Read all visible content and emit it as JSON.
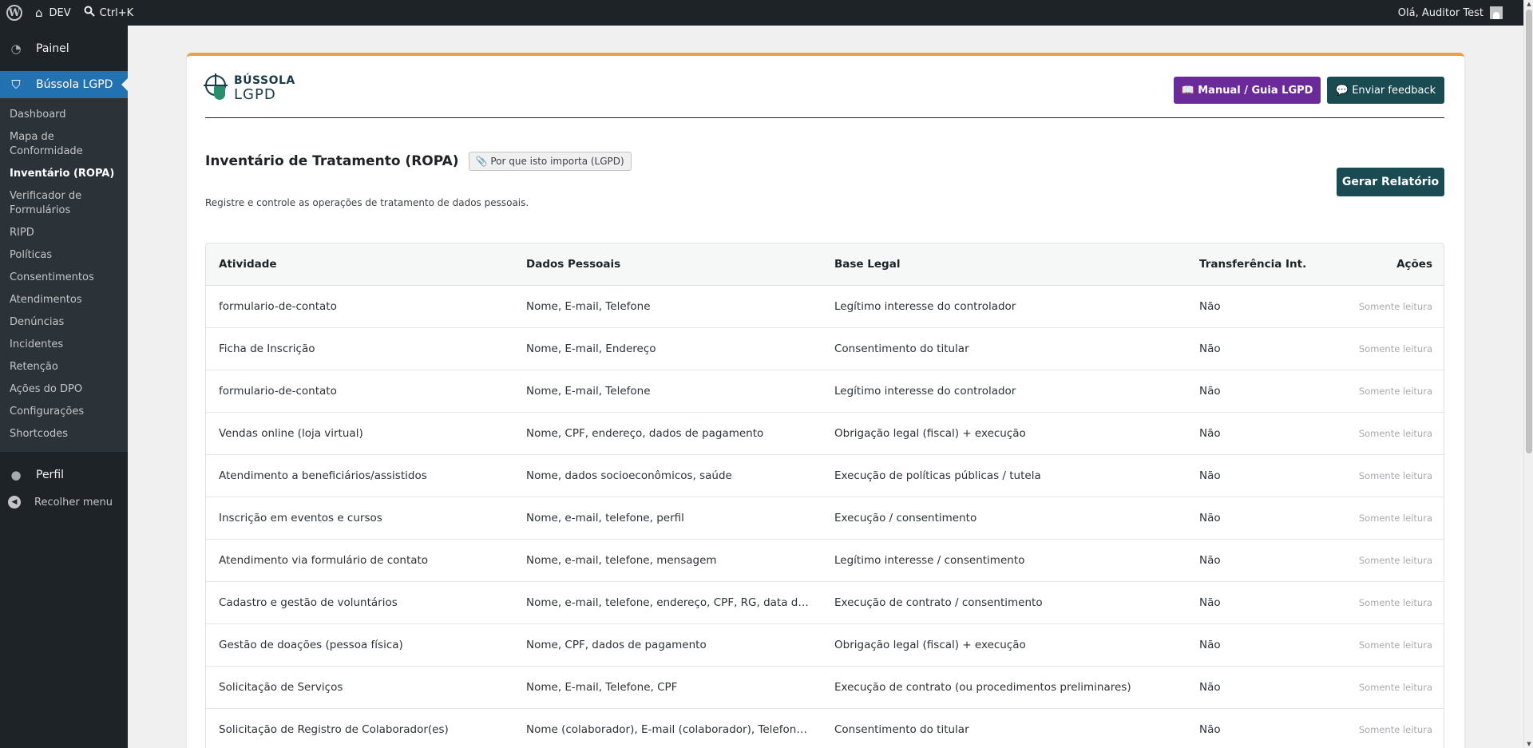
{
  "adminbar": {
    "site_name": "DEV",
    "search_shortcut": "Ctrl+K",
    "greeting": "Olá, Auditor Test"
  },
  "sidebar": {
    "dashboard_label": "Painel",
    "plugin_label": "Bússola LGPD",
    "items": [
      {
        "label": "Dashboard"
      },
      {
        "label": "Mapa de Conformidade"
      },
      {
        "label": "Inventário (ROPA)"
      },
      {
        "label": "Verificador de Formulários"
      },
      {
        "label": "RIPD"
      },
      {
        "label": "Políticas"
      },
      {
        "label": "Consentimentos"
      },
      {
        "label": "Atendimentos"
      },
      {
        "label": "Denúncias"
      },
      {
        "label": "Incidentes"
      },
      {
        "label": "Retenção"
      },
      {
        "label": "Ações do DPO"
      },
      {
        "label": "Configurações"
      },
      {
        "label": "Shortcodes"
      }
    ],
    "profile_label": "Perfil",
    "collapse_label": "Recolher menu"
  },
  "brand": {
    "logo_line1": "BÚSSOLA",
    "logo_line2": "LGPD",
    "manual_button": "📖 Manual / Guia LGPD",
    "feedback_button": "💬 Enviar feedback"
  },
  "page": {
    "title": "Inventário de Tratamento (ROPA)",
    "why_badge": "📎 Por que isto importa (LGPD)",
    "subtitle": "Registre e controle as operações de tratamento de dados pessoais.",
    "report_button": "Gerar Relatório"
  },
  "table": {
    "headers": [
      "Atividade",
      "Dados Pessoais",
      "Base Legal",
      "Transferência Int.",
      "Ações"
    ],
    "rows": [
      {
        "atividade": "formulario-de-contato",
        "dados": "Nome, E-mail, Telefone",
        "base": "Legítimo interesse do controlador",
        "transf": "Não",
        "acao": "Somente leitura"
      },
      {
        "atividade": "Ficha de Inscrição",
        "dados": "Nome, E-mail, Endereço",
        "base": "Consentimento do titular",
        "transf": "Não",
        "acao": "Somente leitura"
      },
      {
        "atividade": "formulario-de-contato",
        "dados": "Nome, E-mail, Telefone",
        "base": "Legítimo interesse do controlador",
        "transf": "Não",
        "acao": "Somente leitura"
      },
      {
        "atividade": "Vendas online (loja virtual)",
        "dados": "Nome, CPF, endereço, dados de pagamento",
        "base": "Obrigação legal (fiscal) + execução",
        "transf": "Não",
        "acao": "Somente leitura"
      },
      {
        "atividade": "Atendimento a beneficiários/assistidos",
        "dados": "Nome, dados socioeconômicos, saúde",
        "base": "Execução de políticas públicas / tutela",
        "transf": "Não",
        "acao": "Somente leitura"
      },
      {
        "atividade": "Inscrição em eventos e cursos",
        "dados": "Nome, e-mail, telefone, perfil",
        "base": "Execução / consentimento",
        "transf": "Não",
        "acao": "Somente leitura"
      },
      {
        "atividade": "Atendimento via formulário de contato",
        "dados": "Nome, e-mail, telefone, mensagem",
        "base": "Legítimo interesse / consentimento",
        "transf": "Não",
        "acao": "Somente leitura"
      },
      {
        "atividade": "Cadastro e gestão de voluntários",
        "dados": "Nome, e-mail, telefone, endereço, CPF, RG, data de n…",
        "base": "Execução de contrato / consentimento",
        "transf": "Não",
        "acao": "Somente leitura"
      },
      {
        "atividade": "Gestão de doações (pessoa física)",
        "dados": "Nome, CPF, dados de pagamento",
        "base": "Obrigação legal (fiscal) + execução",
        "transf": "Não",
        "acao": "Somente leitura"
      },
      {
        "atividade": "Solicitação de Serviços",
        "dados": "Nome, E-mail, Telefone, CPF",
        "base": "Execução de contrato (ou procedimentos preliminares)",
        "transf": "Não",
        "acao": "Somente leitura"
      },
      {
        "atividade": "Solicitação de Registro de Colaborador(es)",
        "dados": "Nome (colaborador), E-mail (colaborador), Telefone (c…",
        "base": "Consentimento do titular",
        "transf": "Não",
        "acao": "Somente leitura"
      }
    ]
  }
}
